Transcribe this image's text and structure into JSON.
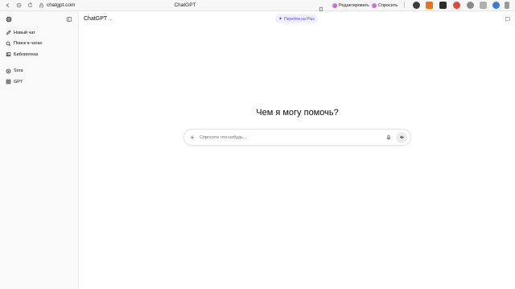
{
  "browser": {
    "url": "chatgpt.com",
    "tab_title": "ChatGPT",
    "edit_label": "Редактировать",
    "ask_label": "Спросить"
  },
  "sidebar": {
    "items": [
      {
        "label": "Новый чат",
        "icon": "edit-icon"
      },
      {
        "label": "Поиск в чатах",
        "icon": "search-icon"
      },
      {
        "label": "Библиотека",
        "icon": "library-icon"
      }
    ],
    "apps": [
      {
        "label": "Sora",
        "icon": "sora-icon"
      },
      {
        "label": "GPT",
        "icon": "grid-icon"
      }
    ]
  },
  "header": {
    "model": "ChatGPT",
    "plus_button": "Перейти на Plus"
  },
  "main": {
    "heading": "Чем я могу помочь?",
    "composer_placeholder": "Спросите что-нибудь..."
  },
  "colors": {
    "accent": "#5b4bd6",
    "sidebar_bg": "#f9f9f9"
  }
}
